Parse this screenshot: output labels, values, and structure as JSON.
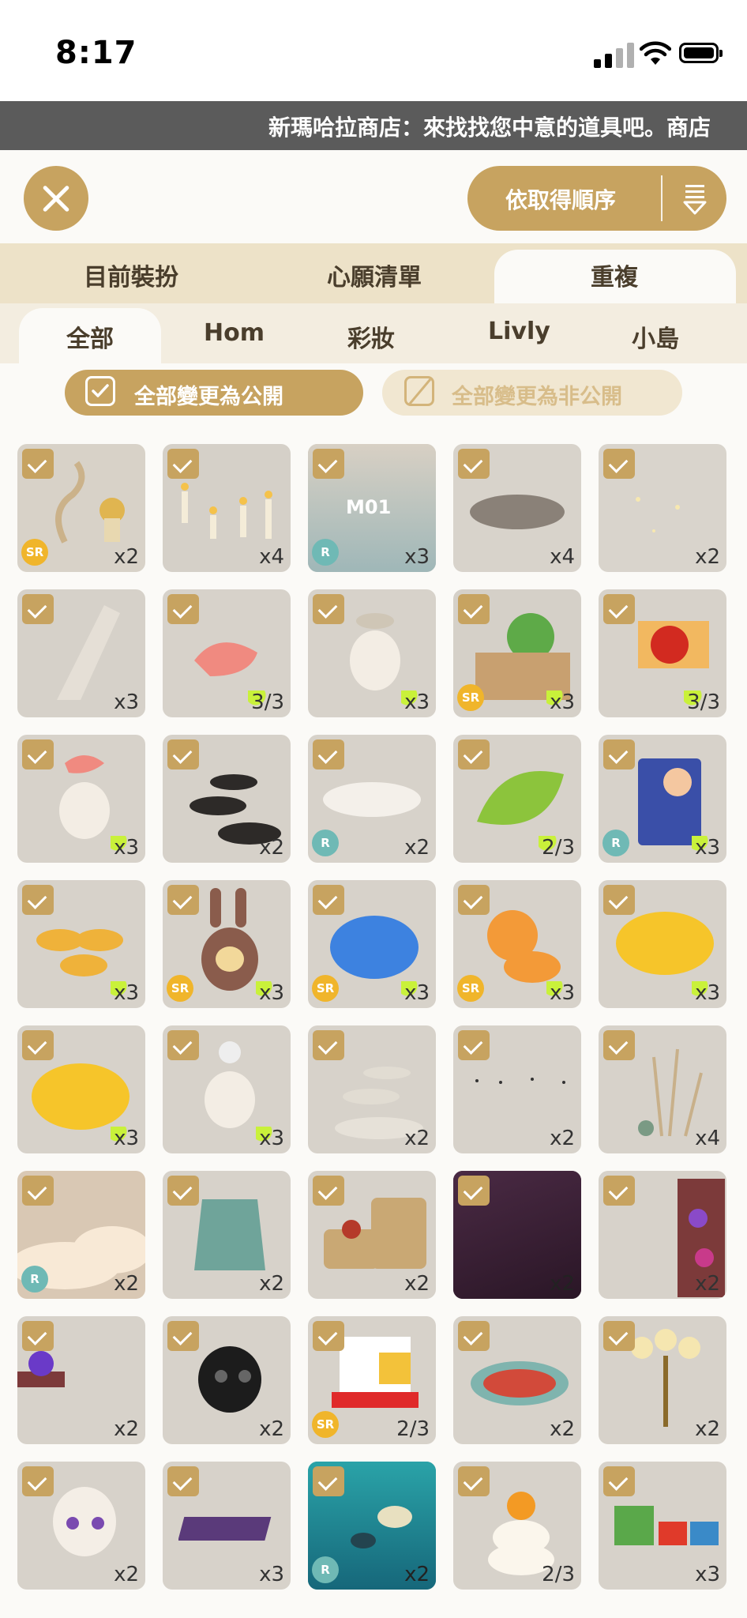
{
  "status": {
    "time": "8:17"
  },
  "ticker": {
    "text": "新瑪哈拉商店：來找找您中意的道具吧。商店"
  },
  "header": {
    "sort_label": "依取得順序"
  },
  "tabs_primary": [
    "目前裝扮",
    "心願清單",
    "重複"
  ],
  "tabs_secondary": [
    "全部",
    "Hom",
    "彩妝",
    "Livly",
    "小島"
  ],
  "actions": {
    "public_label": "全部變更為公開",
    "private_label": "全部變更為非公開"
  },
  "colors": {
    "accent": "#c7a360",
    "check": "#c7a360",
    "sr_badge": "#f0b52b",
    "r_badge": "#6fb9b5",
    "lime": "#c9f13a"
  },
  "items": [
    {
      "name": "golden-decor",
      "count": "x2",
      "badge": "SR",
      "lime": false,
      "bg": "#d8d2c8"
    },
    {
      "name": "candles",
      "count": "x4",
      "badge": "",
      "lime": false,
      "bg": "#d5d0c8"
    },
    {
      "name": "m01-music",
      "count": "x3",
      "badge": "R",
      "lime": false,
      "bg": "#c9c3ba"
    },
    {
      "name": "pebbles",
      "count": "x4",
      "badge": "",
      "lime": false,
      "bg": "#d8d3cb"
    },
    {
      "name": "sparkles",
      "count": "x2",
      "badge": "",
      "lime": false,
      "bg": "#d9d4cc"
    },
    {
      "name": "spotlight",
      "count": "x3",
      "badge": "",
      "lime": false,
      "bg": "#d6d1c9"
    },
    {
      "name": "shrimp",
      "count": "3/3",
      "badge": "",
      "lime": true,
      "bg": "#d7d2ca"
    },
    {
      "name": "oyster-head",
      "count": "x3",
      "badge": "",
      "lime": true,
      "bg": "#d7d2ca"
    },
    {
      "name": "plant-box",
      "count": "x3",
      "badge": "SR",
      "lime": true,
      "bg": "#d5d0c8"
    },
    {
      "name": "ladybug-flag",
      "count": "3/3",
      "badge": "",
      "lime": true,
      "bg": "#d7d2ca"
    },
    {
      "name": "shrimp-head",
      "count": "x3",
      "badge": "",
      "lime": true,
      "bg": "#d7d2ca"
    },
    {
      "name": "stepping-stones",
      "count": "x2",
      "badge": "",
      "lime": false,
      "bg": "#d6d1c9"
    },
    {
      "name": "white-rocks",
      "count": "x2",
      "badge": "R",
      "lime": false,
      "bg": "#d7d2ca"
    },
    {
      "name": "green-leaf",
      "count": "2/3",
      "badge": "",
      "lime": true,
      "bg": "#d7d2ca"
    },
    {
      "name": "poster",
      "count": "x3",
      "badge": "R",
      "lime": true,
      "bg": "#d7d2ca"
    },
    {
      "name": "gold-coins",
      "count": "x3",
      "badge": "",
      "lime": true,
      "bg": "#d7d2ca"
    },
    {
      "name": "bunny-plush",
      "count": "x3",
      "badge": "SR",
      "lime": true,
      "bg": "#d7d2ca"
    },
    {
      "name": "blue-fish",
      "count": "x3",
      "badge": "SR",
      "lime": true,
      "bg": "#d7d2ca"
    },
    {
      "name": "orange-plush",
      "count": "x3",
      "badge": "SR",
      "lime": true,
      "bg": "#d7d2ca"
    },
    {
      "name": "cheese-rock",
      "count": "x3",
      "badge": "",
      "lime": true,
      "bg": "#d7d2ca"
    },
    {
      "name": "yellow-sponge",
      "count": "x3",
      "badge": "",
      "lime": true,
      "bg": "#d7d2ca"
    },
    {
      "name": "bulb-head",
      "count": "x3",
      "badge": "",
      "lime": true,
      "bg": "#d7d2ca"
    },
    {
      "name": "flat-stones",
      "count": "x2",
      "badge": "",
      "lime": false,
      "bg": "#d7d2ca"
    },
    {
      "name": "birds",
      "count": "x2",
      "badge": "",
      "lime": false,
      "bg": "#d7d2ca"
    },
    {
      "name": "grass",
      "count": "x4",
      "badge": "",
      "lime": false,
      "bg": "#d7d2ca"
    },
    {
      "name": "clouds",
      "count": "x2",
      "badge": "R",
      "lime": false,
      "bg": "#d9c8b4"
    },
    {
      "name": "green-jacket",
      "count": "x2",
      "badge": "",
      "lime": false,
      "bg": "#d7d2ca"
    },
    {
      "name": "coffee-sacks",
      "count": "x2",
      "badge": "",
      "lime": false,
      "bg": "#d7d2ca"
    },
    {
      "name": "purple-floor",
      "count": "x2",
      "badge": "",
      "lime": false,
      "bg": "#3a2233"
    },
    {
      "name": "potion-shelf",
      "count": "x2",
      "badge": "",
      "lime": false,
      "bg": "#d7d2ca"
    },
    {
      "name": "potion-table",
      "count": "x2",
      "badge": "",
      "lime": false,
      "bg": "#d7d2ca"
    },
    {
      "name": "plague-mask",
      "count": "x2",
      "badge": "",
      "lime": false,
      "bg": "#d7d2ca"
    },
    {
      "name": "top-hat",
      "count": "2/3",
      "badge": "SR",
      "lime": false,
      "bg": "#d7d2ca"
    },
    {
      "name": "round-rug",
      "count": "x2",
      "badge": "",
      "lime": false,
      "bg": "#d7d2ca"
    },
    {
      "name": "candelabra",
      "count": "x2",
      "badge": "",
      "lime": false,
      "bg": "#d7d2ca"
    },
    {
      "name": "purple-eyes",
      "count": "x2",
      "badge": "",
      "lime": false,
      "bg": "#d7d2ca"
    },
    {
      "name": "purple-mat",
      "count": "x3",
      "badge": "",
      "lime": false,
      "bg": "#d7d2ca"
    },
    {
      "name": "aquarium",
      "count": "x2",
      "badge": "R",
      "lime": false,
      "bg": "#2a8f98"
    },
    {
      "name": "mochi",
      "count": "2/3",
      "badge": "",
      "lime": false,
      "bg": "#d7d2ca"
    },
    {
      "name": "toy-train",
      "count": "x3",
      "badge": "",
      "lime": false,
      "bg": "#d7d2ca"
    }
  ]
}
